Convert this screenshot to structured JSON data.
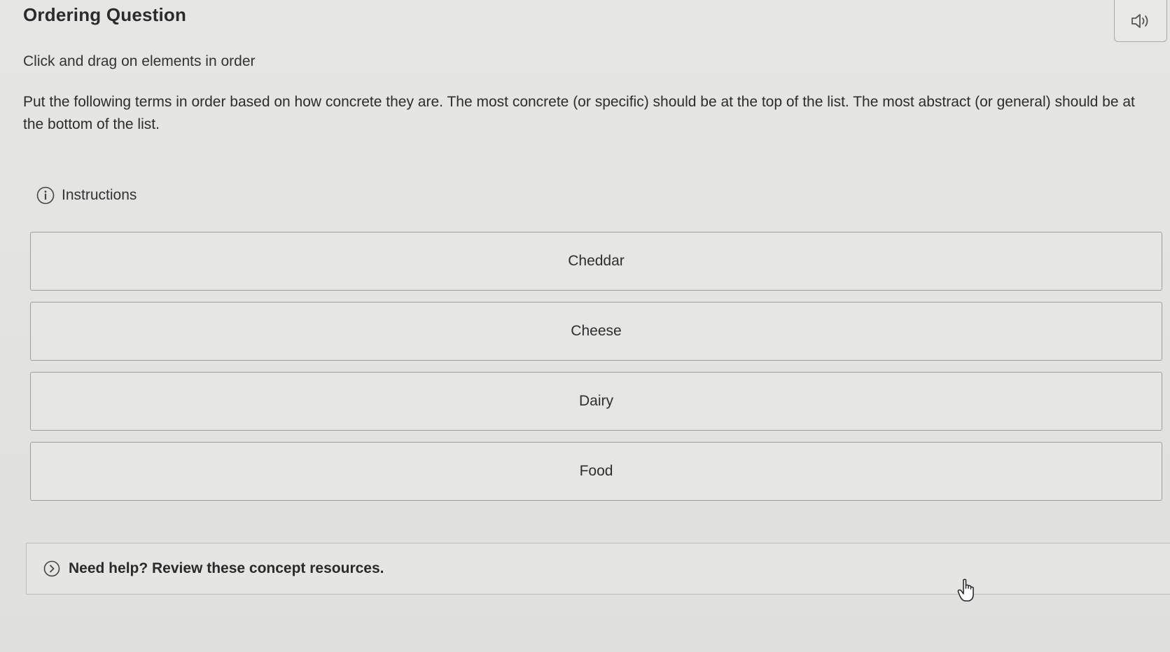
{
  "header": {
    "title": "Ordering Question",
    "audio_icon": "speaker-icon"
  },
  "question": {
    "subtitle": "Click and drag on elements in order",
    "prompt": "Put the following terms in order based on how concrete they are. The most concrete (or specific) should be at the top of the list. The most abstract (or general) should be at the bottom of the list."
  },
  "instructions": {
    "label": "Instructions",
    "icon": "info-icon"
  },
  "items": [
    {
      "label": "Cheddar"
    },
    {
      "label": "Cheese"
    },
    {
      "label": "Dairy"
    },
    {
      "label": "Food"
    }
  ],
  "help": {
    "label": "Need help? Review these concept resources.",
    "icon": "chevron-circle-icon"
  },
  "colors": {
    "background": "#e4e4e2",
    "border": "#9d9d9b",
    "text": "#2a2a2a"
  }
}
